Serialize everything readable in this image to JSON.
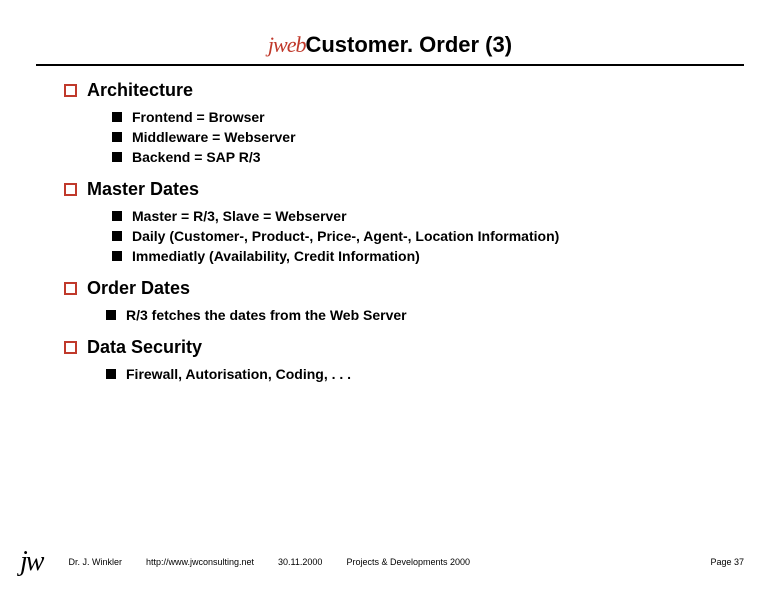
{
  "title": {
    "prefix": "jweb",
    "main": "Customer. Order (3)"
  },
  "sections": [
    {
      "heading": "Architecture",
      "items": [
        "Frontend = Browser",
        "Middleware = Webserver",
        "Backend = SAP R/3"
      ],
      "tight": false
    },
    {
      "heading": "Master Dates",
      "items": [
        "Master = R/3,  Slave = Webserver",
        "Daily (Customer-, Product-, Price-, Agent-, Location Information)",
        "Immediatly (Availability, Credit Information)"
      ],
      "tight": false
    },
    {
      "heading": "Order Dates",
      "items": [
        "R/3 fetches the dates from the Web Server"
      ],
      "tight": true
    },
    {
      "heading": "Data Security",
      "items": [
        "Firewall, Autorisation, Coding, . . ."
      ],
      "tight": true
    }
  ],
  "footer": {
    "logo": "jw",
    "author": "Dr. J. Winkler",
    "url": "http://www.jwconsulting.net",
    "date": "30.11.2000",
    "project": "Projects & Developments 2000",
    "page": "Page 37"
  }
}
